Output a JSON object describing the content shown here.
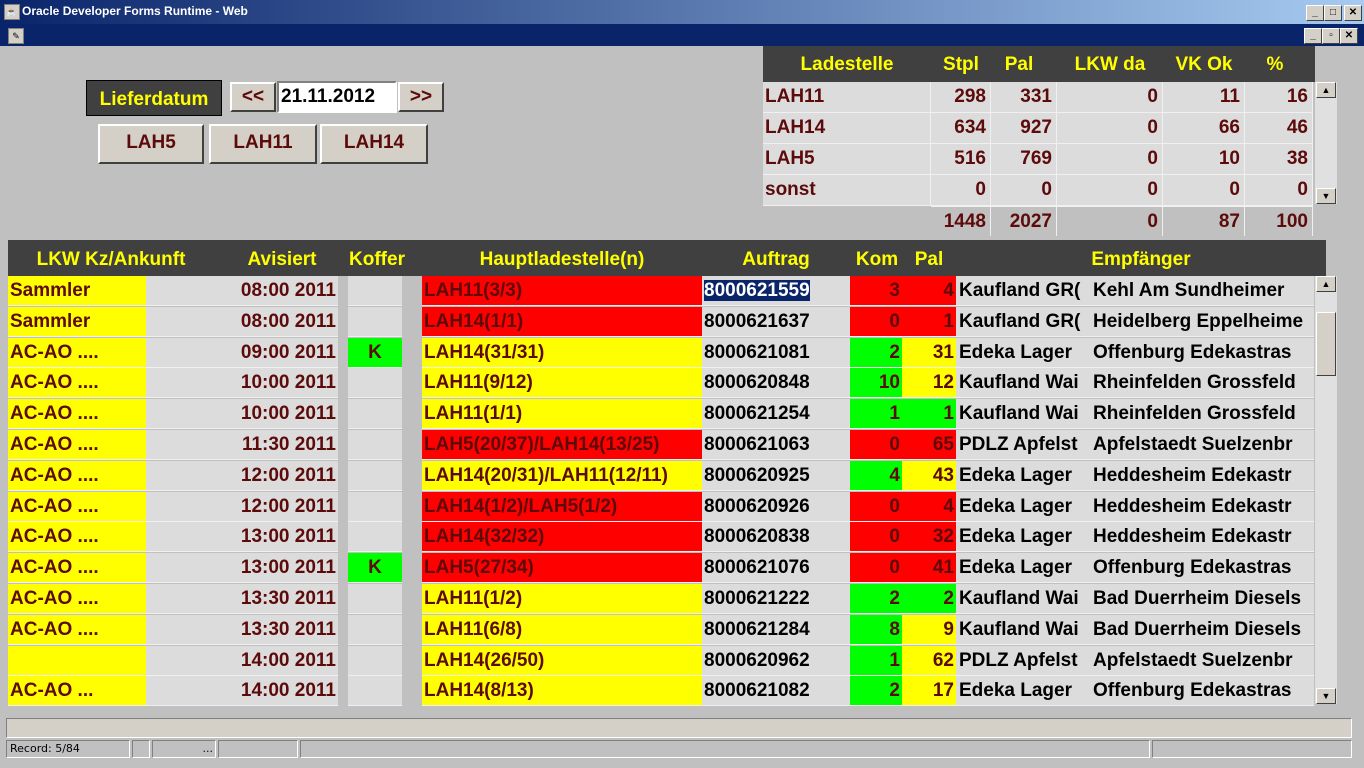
{
  "window": {
    "title": "Oracle Developer Forms Runtime - Web",
    "buttons": [
      "_",
      "□",
      "✕"
    ],
    "inner_buttons": [
      "_",
      "▫",
      "✕"
    ]
  },
  "controls": {
    "lieferdatum_label": "Lieferdatum",
    "prev_label": "<<",
    "date_value": "21.11.2012",
    "next_label": ">>",
    "filter_buttons": [
      "LAH5",
      "LAH11",
      "LAH14"
    ]
  },
  "summary": {
    "headers": [
      "Ladestelle",
      "Stpl",
      "Pal",
      "LKW da",
      "VK Ok",
      "%"
    ],
    "rows": [
      [
        "LAH11",
        "298",
        "331",
        "0",
        "11",
        "16"
      ],
      [
        "LAH14",
        "634",
        "927",
        "0",
        "66",
        "46"
      ],
      [
        "LAH5",
        "516",
        "769",
        "0",
        "10",
        "38"
      ],
      [
        "sonst",
        "0",
        "0",
        "0",
        "0",
        "0"
      ]
    ],
    "totals": [
      "1448",
      "2027",
      "0",
      "87",
      "100"
    ]
  },
  "table": {
    "headers": [
      "LKW Kz/Ankunft",
      "Avisiert",
      "Koffer",
      "Hauptladestelle(n)",
      "Auftrag",
      "Kom",
      "Pal",
      "Empfänger"
    ],
    "rows": [
      {
        "lkw": "Sammler",
        "avis": "08:00 2011",
        "koffer": "",
        "haupt": "LAH11(3/3)",
        "haupt_color": "red",
        "auftrag": "8000621559",
        "kom": "3",
        "kom_color": "red",
        "pal": "4",
        "pal_color": "red",
        "emp1": "Kaufland GR(",
        "emp2": "Kehl Am Sundheimer"
      },
      {
        "lkw": "Sammler",
        "avis": "08:00 2011",
        "koffer": "",
        "haupt": "LAH14(1/1)",
        "haupt_color": "red",
        "auftrag": "8000621637",
        "kom": "0",
        "kom_color": "red",
        "pal": "1",
        "pal_color": "red",
        "emp1": "Kaufland GR(",
        "emp2": "Heidelberg Eppelheime"
      },
      {
        "lkw": "AC-AO ....",
        "avis": "09:00 2011",
        "koffer": "K",
        "haupt": "LAH14(31/31)",
        "haupt_color": "yellow",
        "auftrag": "8000621081",
        "kom": "2",
        "kom_color": "green",
        "pal": "31",
        "pal_color": "yellow",
        "emp1": "Edeka Lager",
        "emp2": "Offenburg Edekastras"
      },
      {
        "lkw": "AC-AO ....",
        "avis": "10:00 2011",
        "koffer": "",
        "haupt": "LAH11(9/12)",
        "haupt_color": "yellow",
        "auftrag": "8000620848",
        "kom": "10",
        "kom_color": "green",
        "pal": "12",
        "pal_color": "yellow",
        "emp1": "Kaufland Wai",
        "emp2": "Rheinfelden Grossfeld"
      },
      {
        "lkw": "AC-AO ....",
        "avis": "10:00 2011",
        "koffer": "",
        "haupt": "LAH11(1/1)",
        "haupt_color": "yellow",
        "auftrag": "8000621254",
        "kom": "1",
        "kom_color": "green",
        "pal": "1",
        "pal_color": "green",
        "emp1": "Kaufland Wai",
        "emp2": "Rheinfelden Grossfeld"
      },
      {
        "lkw": "AC-AO ....",
        "avis": "11:30 2011",
        "koffer": "",
        "haupt": "LAH5(20/37)/LAH14(13/25)",
        "haupt_color": "red",
        "auftrag": "8000621063",
        "kom": "0",
        "kom_color": "red",
        "pal": "65",
        "pal_color": "red",
        "emp1": "PDLZ Apfelst",
        "emp2": "Apfelstaedt Suelzenbr"
      },
      {
        "lkw": "AC-AO ....",
        "avis": "12:00 2011",
        "koffer": "",
        "haupt": "LAH14(20/31)/LAH11(12/11)",
        "haupt_color": "yellow",
        "auftrag": "8000620925",
        "kom": "4",
        "kom_color": "green",
        "pal": "43",
        "pal_color": "yellow",
        "emp1": "Edeka Lager",
        "emp2": "Heddesheim Edekastr"
      },
      {
        "lkw": "AC-AO ....",
        "avis": "12:00 2011",
        "koffer": "",
        "haupt": "LAH14(1/2)/LAH5(1/2)",
        "haupt_color": "red",
        "auftrag": "8000620926",
        "kom": "0",
        "kom_color": "red",
        "pal": "4",
        "pal_color": "red",
        "emp1": "Edeka Lager",
        "emp2": "Heddesheim Edekastr"
      },
      {
        "lkw": "AC-AO ....",
        "avis": "13:00 2011",
        "koffer": "",
        "haupt": "LAH14(32/32)",
        "haupt_color": "red",
        "auftrag": "8000620838",
        "kom": "0",
        "kom_color": "red",
        "pal": "32",
        "pal_color": "red",
        "emp1": "Edeka Lager",
        "emp2": "Heddesheim Edekastr"
      },
      {
        "lkw": "AC-AO ....",
        "avis": "13:00 2011",
        "koffer": "K",
        "haupt": "LAH5(27/34)",
        "haupt_color": "red",
        "auftrag": "8000621076",
        "kom": "0",
        "kom_color": "red",
        "pal": "41",
        "pal_color": "red",
        "emp1": "Edeka Lager",
        "emp2": "Offenburg Edekastras"
      },
      {
        "lkw": "AC-AO ....",
        "avis": "13:30 2011",
        "koffer": "",
        "haupt": "LAH11(1/2)",
        "haupt_color": "yellow",
        "auftrag": "8000621222",
        "kom": "2",
        "kom_color": "green",
        "pal": "2",
        "pal_color": "green",
        "emp1": "Kaufland Wai",
        "emp2": "Bad Duerrheim Diesels"
      },
      {
        "lkw": "AC-AO ....",
        "avis": "13:30 2011",
        "koffer": "",
        "haupt": "LAH11(6/8)",
        "haupt_color": "yellow",
        "auftrag": "8000621284",
        "kom": "8",
        "kom_color": "green",
        "pal": "9",
        "pal_color": "yellow",
        "emp1": "Kaufland Wai",
        "emp2": "Bad Duerrheim Diesels"
      },
      {
        "lkw": "",
        "avis": "14:00 2011",
        "koffer": "",
        "haupt": "LAH14(26/50)",
        "haupt_color": "yellow",
        "auftrag": "8000620962",
        "kom": "1",
        "kom_color": "green",
        "pal": "62",
        "pal_color": "yellow",
        "emp1": "PDLZ Apfelst",
        "emp2": "Apfelstaedt Suelzenbr"
      },
      {
        "lkw": "AC-AO ...",
        "avis": "14:00 2011",
        "koffer": "",
        "haupt": "LAH14(8/13)",
        "haupt_color": "yellow",
        "auftrag": "8000621082",
        "kom": "2",
        "kom_color": "green",
        "pal": "17",
        "pal_color": "yellow",
        "emp1": "Edeka Lager",
        "emp2": "Offenburg Edekastras"
      }
    ]
  },
  "status": {
    "record": "Record: 5/84",
    "ellipsis": "..."
  }
}
